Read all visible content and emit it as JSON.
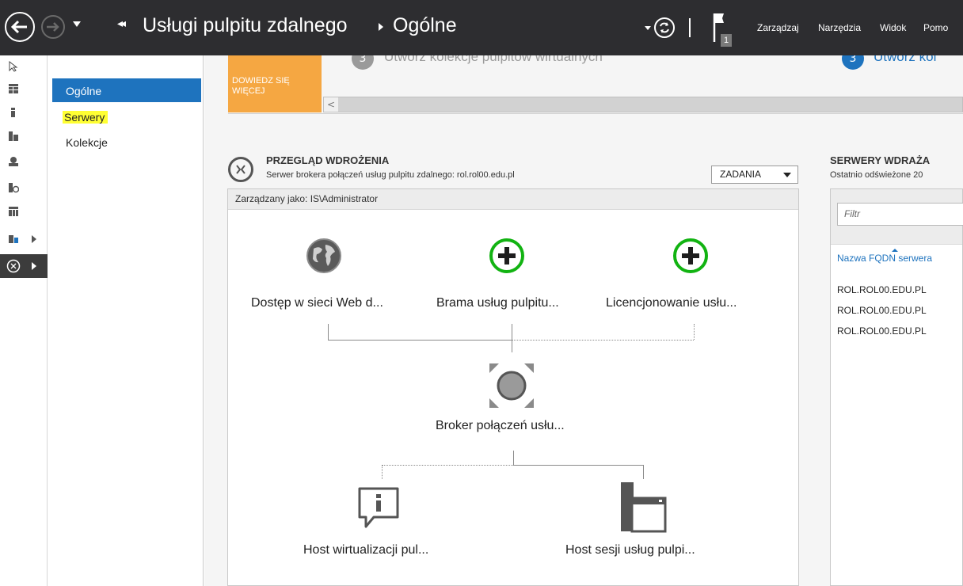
{
  "titlebar": {
    "breadcrumb_root": "Usługi pulpitu zdalnego",
    "breadcrumb_page": "Ogólne",
    "notification_count": "1",
    "menu": [
      "Zarządzaj",
      "Narzędzia",
      "Widok",
      "Pomo"
    ]
  },
  "secnav": {
    "items": [
      {
        "label": "Ogólne"
      },
      {
        "label": "Serwery"
      },
      {
        "label": "Kolekcje"
      }
    ]
  },
  "quickstart": {
    "learn_more": "DOWIEDZ SIĘ WIĘCEJ",
    "step_a_num": "3",
    "step_a_label": "Utwórz kolekcje pulpitów wirtualnych",
    "step_b_num": "3",
    "step_b_label": "Utwórz kol",
    "scroll_left": "<"
  },
  "overview": {
    "title": "PRZEGLĄD WDROŻENIA",
    "subtitle": "Serwer brokera połączeń usług pulpitu zdalnego: rol.rol00.edu.pl",
    "tasks": "ZADANIA",
    "managed_as": "Zarządzany jako: IS\\Administrator",
    "nodes": {
      "web_access": "Dostęp w sieci Web d...",
      "gateway": "Brama usług pulpitu...",
      "licensing": "Licencjonowanie usłu...",
      "broker": "Broker połączeń usłu...",
      "virtualization_host": "Host wirtualizacji pul...",
      "session_host": "Host sesji usług pulpi..."
    }
  },
  "servers": {
    "title": "SERWERY WDRAŻA",
    "subtitle": "Ostatnio odświeżone 20",
    "filter_placeholder": "Filtr",
    "column": "Nazwa FQDN serwera",
    "rows": [
      "ROL.ROL00.EDU.PL",
      "ROL.ROL00.EDU.PL",
      "ROL.ROL00.EDU.PL"
    ]
  },
  "colors": {
    "titlebar": "#2d2d30",
    "selected": "#1e73be",
    "highlight": "#ffff33",
    "learn_more": "#f5a742",
    "add_green": "#12b312"
  }
}
